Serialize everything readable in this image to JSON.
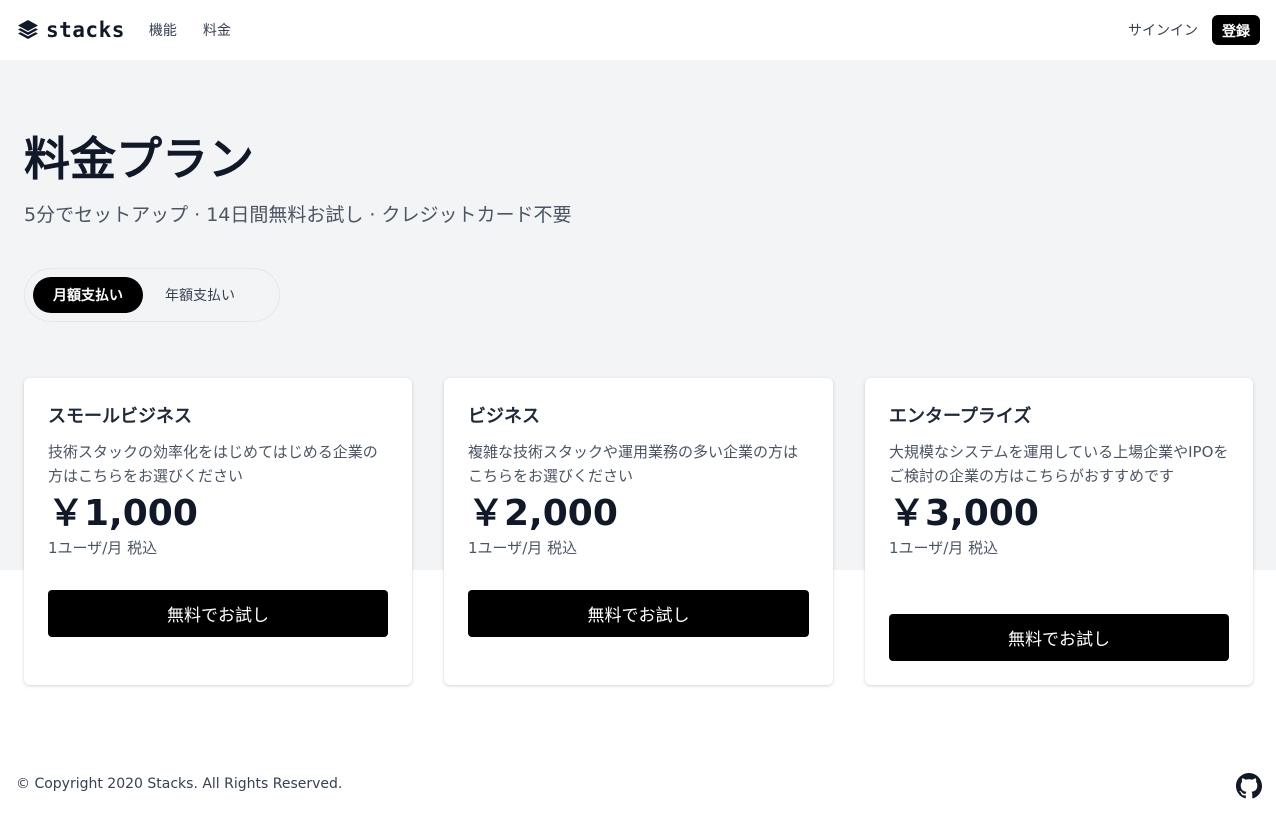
{
  "header": {
    "logo_text": "stacks",
    "nav": [
      {
        "label": "機能"
      },
      {
        "label": "料金"
      }
    ],
    "signin_label": "サインイン",
    "register_label": "登録"
  },
  "hero": {
    "title": "料金プラン",
    "subtitle": "5分でセットアップ · 14日間無料お試し · クレジットカード不要",
    "toggle": {
      "monthly": "月額支払い",
      "yearly": "年額支払い",
      "selected": "monthly"
    }
  },
  "plans": [
    {
      "name": "スモールビジネス",
      "description": "技術スタックの効率化をはじめてはじめる企業の方はこちらをお選びください",
      "price": "￥1,000",
      "unit": "1ユーザ/月 税込",
      "cta": "無料でお試し"
    },
    {
      "name": "ビジネス",
      "description": "複雑な技術スタックや運用業務の多い企業の方はこちらをお選びください",
      "price": "￥2,000",
      "unit": "1ユーザ/月 税込",
      "cta": "無料でお試し"
    },
    {
      "name": "エンタープライズ",
      "description": "大規模なシステムを運用している上場企業やIPOをご検討の企業の方はこちらがおすすめです",
      "price": "￥3,000",
      "unit": "1ユーザ/月 税込",
      "cta": "無料でお試し"
    }
  ],
  "footer": {
    "copyright": "© Copyright 2020 Stacks. All Rights Reserved."
  },
  "icons": {
    "logo": "stack-layers-icon",
    "github": "github-icon"
  },
  "colors": {
    "primary": "#000000",
    "band": "#f3f4f6",
    "text": "#111827"
  }
}
